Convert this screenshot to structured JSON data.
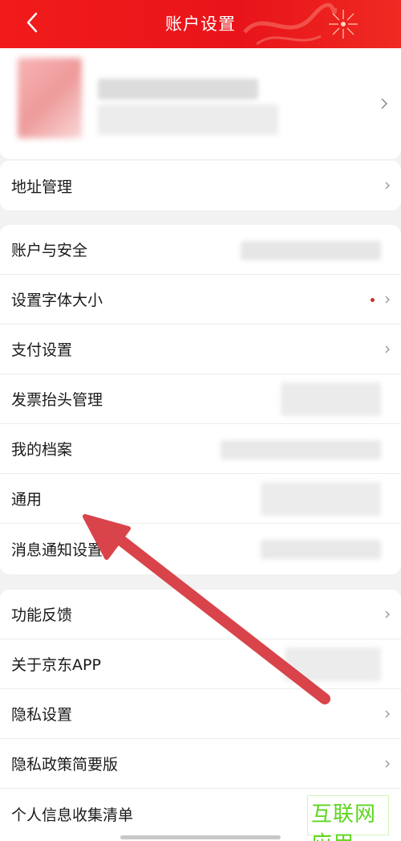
{
  "header": {
    "title": "账户设置"
  },
  "groups": [
    [
      {
        "label": "地址管理"
      }
    ],
    [
      {
        "label": "账户与安全"
      },
      {
        "label": "设置字体大小"
      },
      {
        "label": "支付设置"
      },
      {
        "label": "发票抬头管理"
      },
      {
        "label": "我的档案"
      },
      {
        "label": "通用"
      },
      {
        "label": "消息通知设置"
      }
    ],
    [
      {
        "label": "功能反馈"
      },
      {
        "label": "关于京东APP"
      },
      {
        "label": "隐私设置"
      },
      {
        "label": "隐私政策简要版"
      },
      {
        "label": "个人信息收集清单"
      }
    ]
  ],
  "watermark": {
    "text": "互联网应用"
  },
  "colors": {
    "header_red": "#ee1b1b",
    "arrow_red": "#d9434a",
    "dot_red": "#c9302c",
    "watermark_green": "#5cd61e"
  }
}
